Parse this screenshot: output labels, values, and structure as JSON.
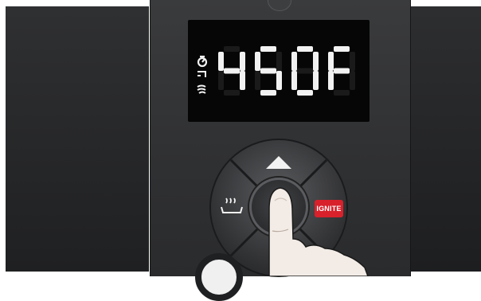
{
  "display": {
    "digits": [
      "4",
      "5",
      "0",
      "F"
    ],
    "status_icons": [
      "timer-icon",
      "probe-icon",
      "smoke-icon"
    ]
  },
  "buttons": {
    "ignite_label": "IGNITE",
    "up_icon": "up-arrow-icon",
    "smoke_icon": "smoke-tray-icon"
  },
  "colors": {
    "ignite": "#d8212b",
    "display_segment": "#f2f2f2",
    "display_segment_off": "#1a1a1a"
  }
}
